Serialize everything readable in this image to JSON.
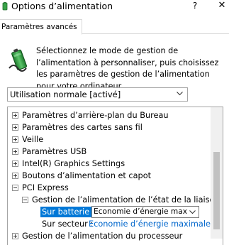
{
  "window": {
    "title": "Options d’alimentation",
    "help_label": "?",
    "close_label": "✕"
  },
  "tabs": [
    {
      "label": "Paramètres avancés",
      "active": true
    }
  ],
  "description": "Sélectionnez le mode de gestion de l’alimentation à personnaliser, puis choisissez les paramètres de gestion de l’alimentation pour votre ordinateur.",
  "scheme": {
    "selected": "Utilisation normale [activé]"
  },
  "tree": {
    "items": [
      {
        "label": "Paramètres d’arrière-plan du Bureau",
        "expander": "+"
      },
      {
        "label": "Paramètres des cartes sans fil",
        "expander": "+"
      },
      {
        "label": "Veille",
        "expander": "+"
      },
      {
        "label": "Paramètres USB",
        "expander": "+"
      },
      {
        "label": "Intel(R) Graphics Settings",
        "expander": "+"
      },
      {
        "label": "Boutons d’alimentation et capot",
        "expander": "+"
      },
      {
        "label": "PCI Express",
        "expander": "−"
      },
      {
        "label": "Gestion de l’alimentation de l’état de la liaison",
        "expander": "−"
      },
      {
        "label": "Sur batterie :",
        "value": "Economie d’énergie maximale",
        "selected": true
      },
      {
        "label": "Sur secteur :",
        "value": "Economie d’énergie maximale"
      },
      {
        "label": "Gestion de l’alimentation du processeur",
        "expander": "+"
      }
    ]
  },
  "colors": {
    "accent": "#0078d7",
    "link": "#0066cc",
    "scrollbar_thumb": "#c1c1c1"
  }
}
